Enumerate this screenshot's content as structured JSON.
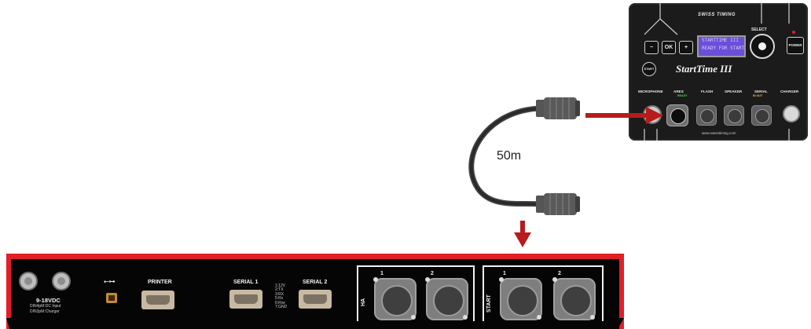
{
  "device": {
    "brand": "SWISS TIMING",
    "model": "StartTime III",
    "lcd_line1": "STARTTIME III",
    "lcd_line2": "READY FOR START",
    "buttons": {
      "minus": "−",
      "ok": "OK",
      "plus": "+",
      "power": "POWER",
      "start": "START"
    },
    "select_label": "SELECT",
    "connectors": {
      "microphone": "MICROPHONE",
      "ares": "ARES",
      "ares_sub": "READY",
      "flash": "FLASH",
      "speaker": "SPEAKER",
      "serial": "SERIAL",
      "serial_sub": "IN    OUT",
      "charger": "CHARGER"
    },
    "url": "www.swisstiming.com"
  },
  "cable": {
    "label": "50m"
  },
  "base_unit": {
    "power_label": "9-18VDC",
    "power_note_1": "DIN4pM:DC Input",
    "power_note_2": "DIN3pM:Charger",
    "usb_symbol": "⭠⊶",
    "printer_label": "PRINTER",
    "serial1_label": "SERIAL 1",
    "serial2_label": "SERIAL 2",
    "pinout": [
      "1:12V",
      "2:TX",
      "3:RX",
      "5:Rx",
      "6:Rxe",
      "7:GND"
    ],
    "ha_group": {
      "label": "HA",
      "port1": "1",
      "port2": "2"
    },
    "start_group": {
      "label": "START",
      "port1": "1",
      "port2": "2"
    }
  },
  "colors": {
    "arrow": "#b81b1b",
    "base_border": "#e21f26",
    "lcd": "#6b4fd8"
  }
}
